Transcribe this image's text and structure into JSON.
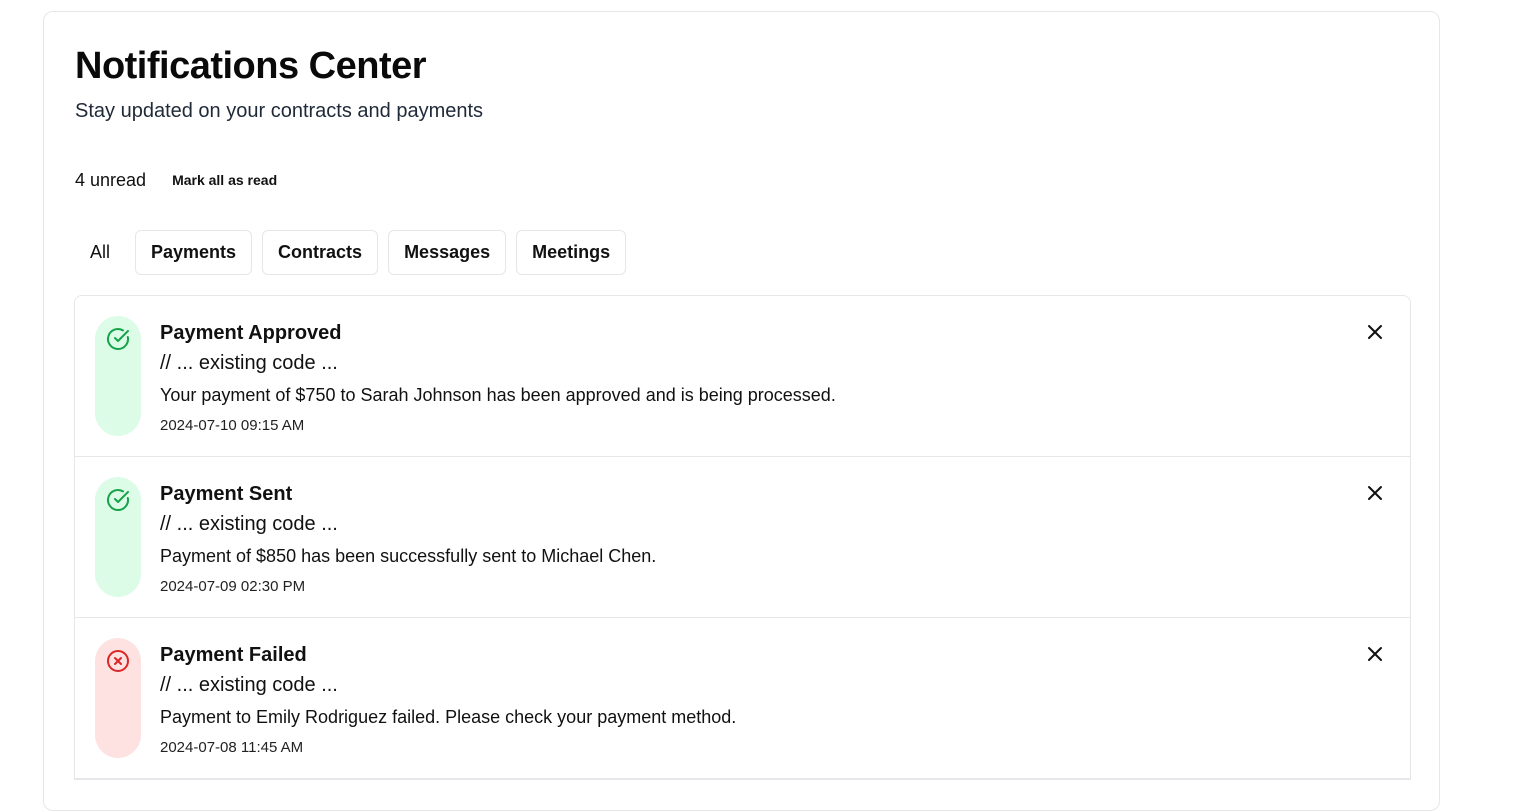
{
  "header": {
    "title": "Notifications Center",
    "subtitle": "Stay updated on your contracts and payments"
  },
  "toolbar": {
    "unread": "4 unread",
    "mark_all_label": "Mark all as read"
  },
  "tabs": [
    {
      "label": "All",
      "active": true
    },
    {
      "label": "Payments",
      "active": false
    },
    {
      "label": "Contracts",
      "active": false
    },
    {
      "label": "Messages",
      "active": false
    },
    {
      "label": "Meetings",
      "active": false
    }
  ],
  "notifications": [
    {
      "title": "Payment Approved",
      "code": "// ... existing code ...",
      "message": "Your payment of $750 to Sarah Johnson has been approved and is being processed.",
      "time": "2024-07-10 09:15 AM",
      "status": "success",
      "icon": "check-circle-icon"
    },
    {
      "title": "Payment Sent",
      "code": "// ... existing code ...",
      "message": "Payment of $850 has been successfully sent to Michael Chen.",
      "time": "2024-07-09 02:30 PM",
      "status": "success",
      "icon": "check-circle-icon"
    },
    {
      "title": "Payment Failed",
      "code": "// ... existing code ...",
      "message": "Payment to Emily Rodriguez failed. Please check your payment method.",
      "time": "2024-07-08 11:45 AM",
      "status": "error",
      "icon": "x-circle-icon"
    }
  ],
  "colors": {
    "success_icon": "#16a34a",
    "success_bg": "#dcfce7",
    "error_icon": "#dc2626",
    "error_bg": "#fee2e2",
    "border": "#e5e7eb"
  }
}
